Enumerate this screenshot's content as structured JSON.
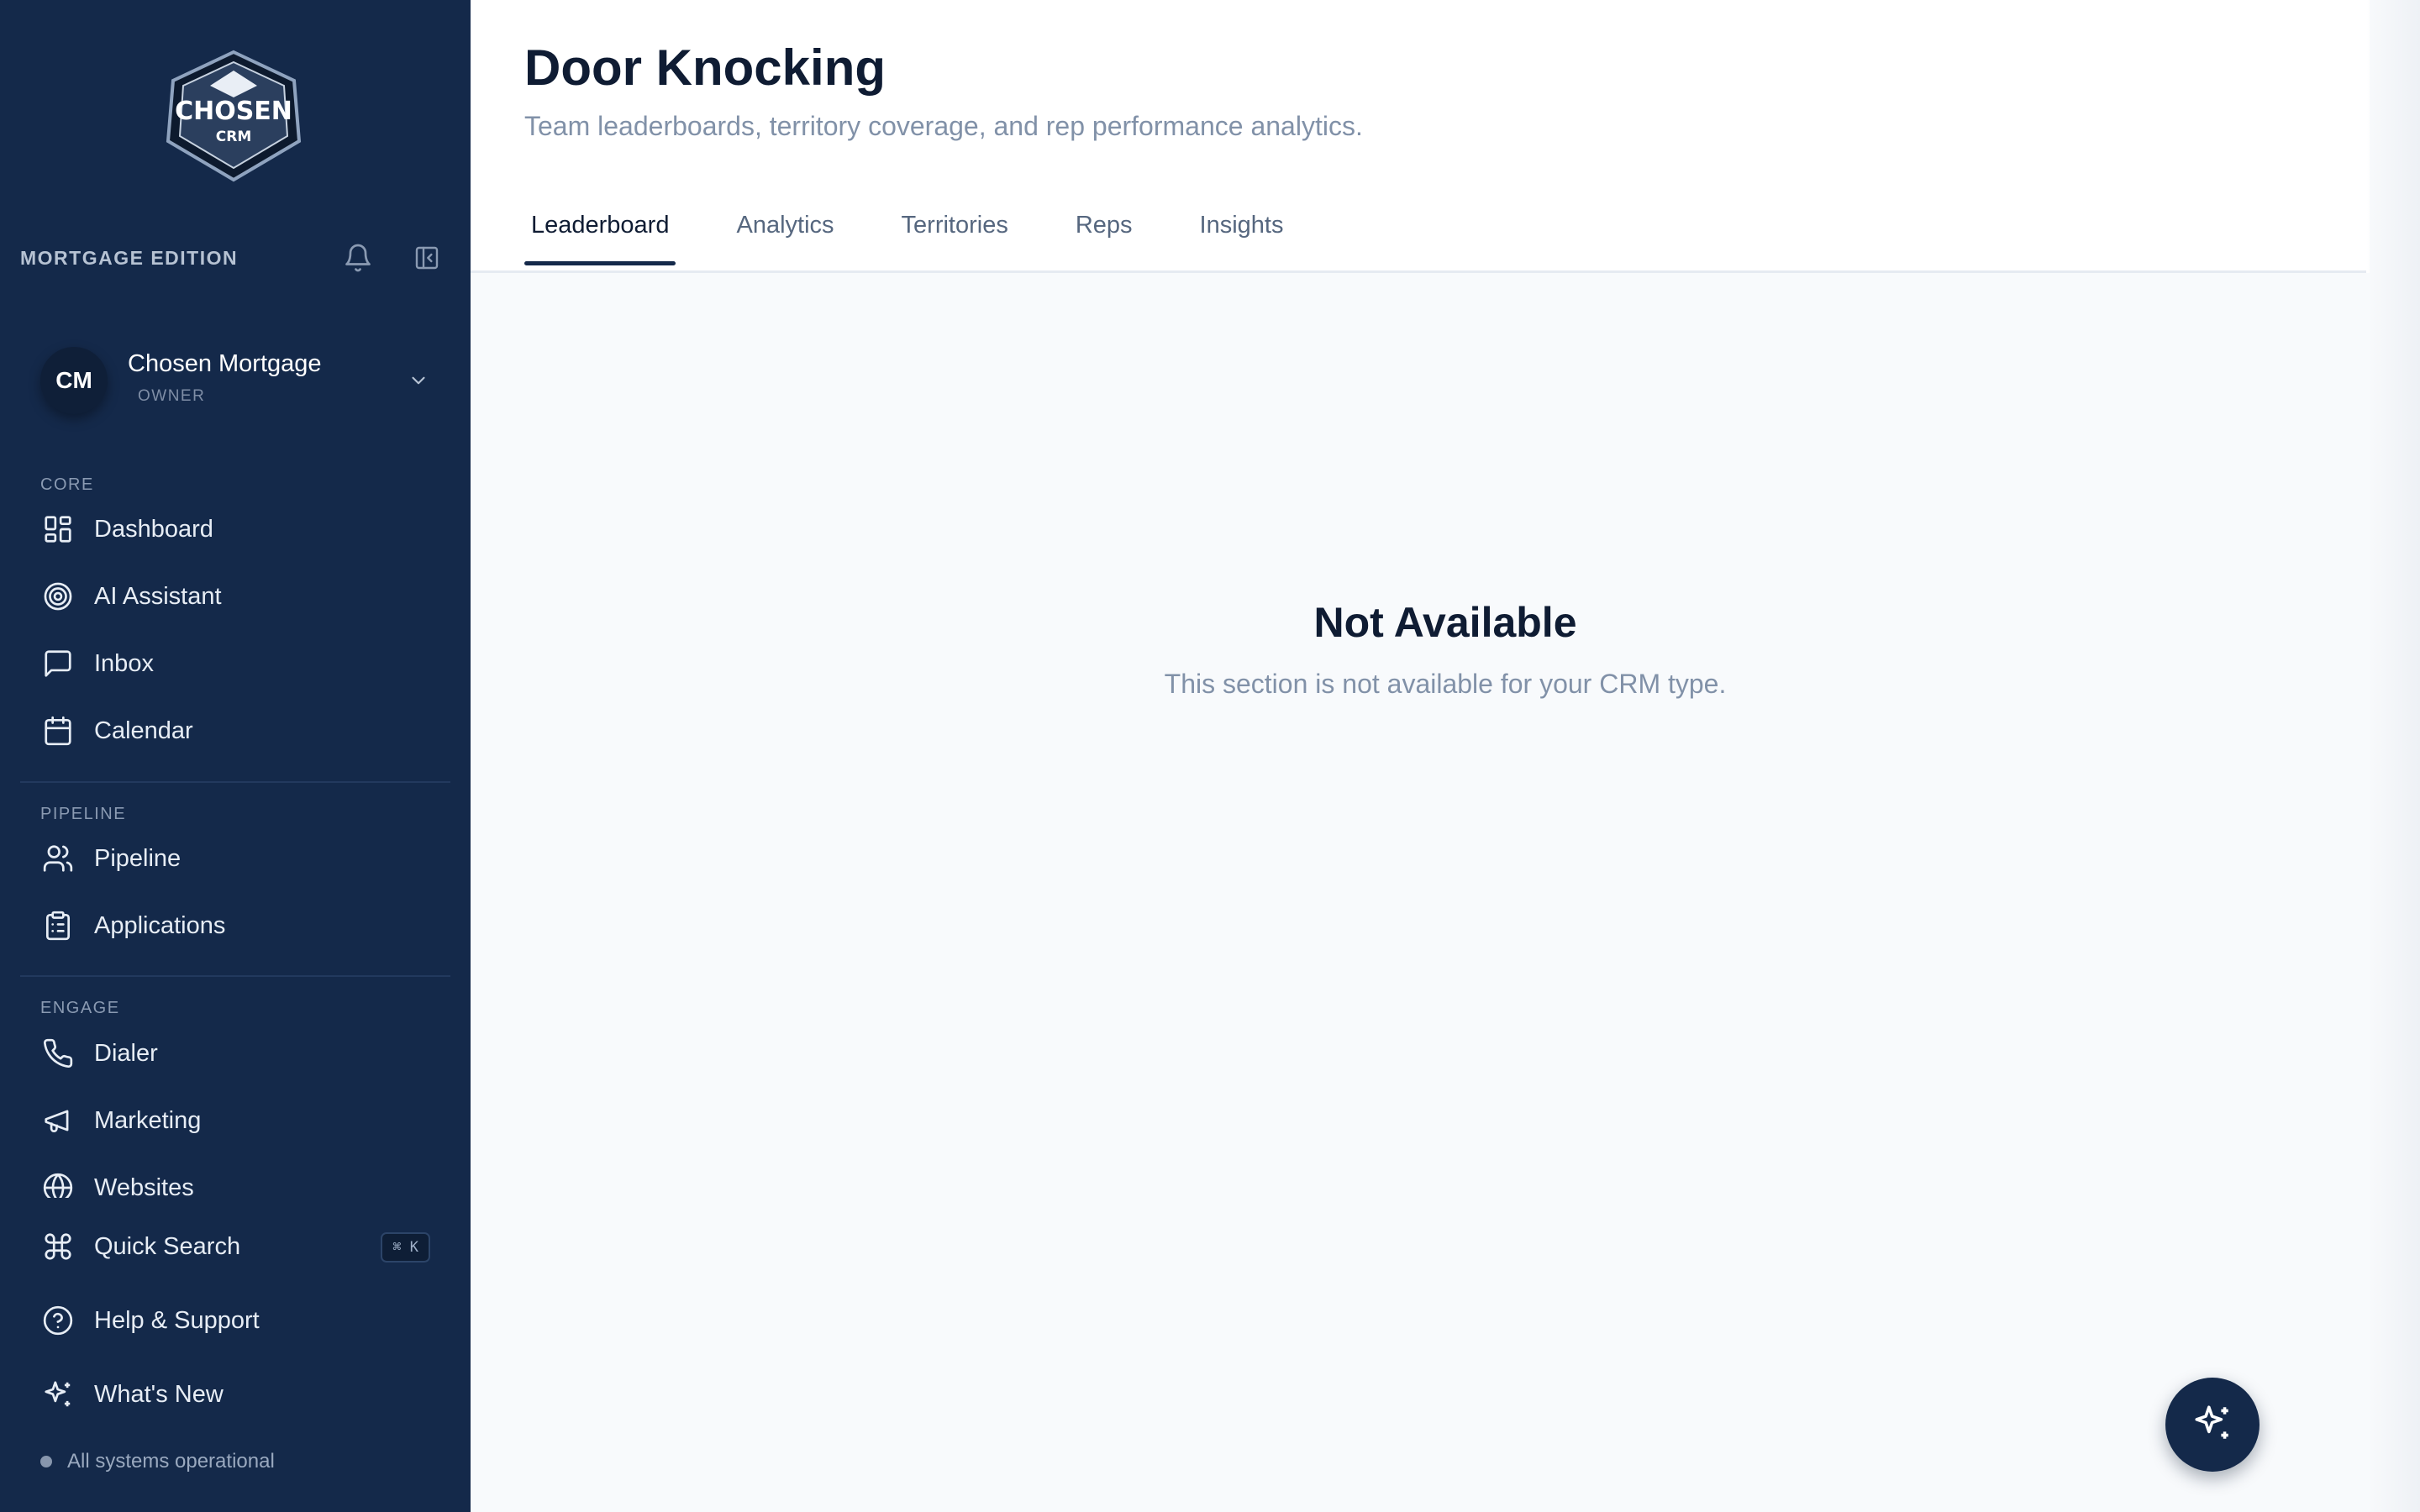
{
  "sidebar": {
    "edition": "MORTGAGE EDITION",
    "logo": {
      "line1": "CHOSEN",
      "line2": "CRM"
    },
    "account": {
      "initials": "CM",
      "name": "Chosen Mortgage",
      "role": "OWNER"
    },
    "sections": {
      "core": "CORE",
      "pipeline": "PIPELINE",
      "engage": "ENGAGE"
    },
    "items": {
      "dashboard": "Dashboard",
      "ai_assistant": "AI Assistant",
      "inbox": "Inbox",
      "calendar": "Calendar",
      "pipeline": "Pipeline",
      "applications": "Applications",
      "dialer": "Dialer",
      "marketing": "Marketing",
      "websites": "Websites"
    },
    "footer": {
      "quick_search": "Quick Search",
      "shortcut": "⌘ K",
      "help": "Help & Support",
      "whats_new": "What's New",
      "status": "All systems operational"
    }
  },
  "header": {
    "title": "Door Knocking",
    "subtitle": "Team leaderboards, territory coverage, and rep performance analytics.",
    "tabs": [
      "Leaderboard",
      "Analytics",
      "Territories",
      "Reps",
      "Insights"
    ],
    "active_tab": "Leaderboard"
  },
  "main": {
    "empty_title": "Not Available",
    "empty_message": "This section is not available for your CRM type."
  },
  "icons": {
    "bell": "bell-icon",
    "collapse": "sidebar-collapse-icon",
    "fab": "sparkles-icon"
  },
  "colors": {
    "sidebar_bg": "#14294a",
    "accent": "#14294a",
    "page_bg": "#f8fafc"
  }
}
